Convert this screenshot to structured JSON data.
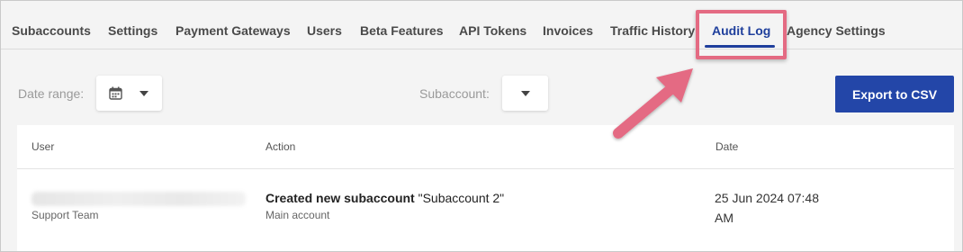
{
  "tabs": [
    {
      "label": "Subaccounts"
    },
    {
      "label": "Settings"
    },
    {
      "label": "Payment Gateways"
    },
    {
      "label": "Users"
    },
    {
      "label": "Beta Features"
    },
    {
      "label": "API Tokens"
    },
    {
      "label": "Invoices"
    },
    {
      "label": "Traffic History"
    },
    {
      "label": "Audit Log"
    },
    {
      "label": "Agency Settings"
    }
  ],
  "active_tab": "Audit Log",
  "filters": {
    "date_range_label": "Date range:",
    "subaccount_label": "Subaccount:"
  },
  "export_button": "Export to CSV",
  "table": {
    "headers": {
      "user": "User",
      "action": "Action",
      "date": "Date"
    },
    "rows": [
      {
        "user_role": "Support Team",
        "action_bold": "Created new subaccount",
        "action_rest": "\"Subaccount 2\"",
        "action_sub": "Main account",
        "date": "25 Jun 2024 07:48 AM"
      }
    ]
  },
  "colors": {
    "accent": "#2346a8",
    "highlight": "#e46b83"
  }
}
